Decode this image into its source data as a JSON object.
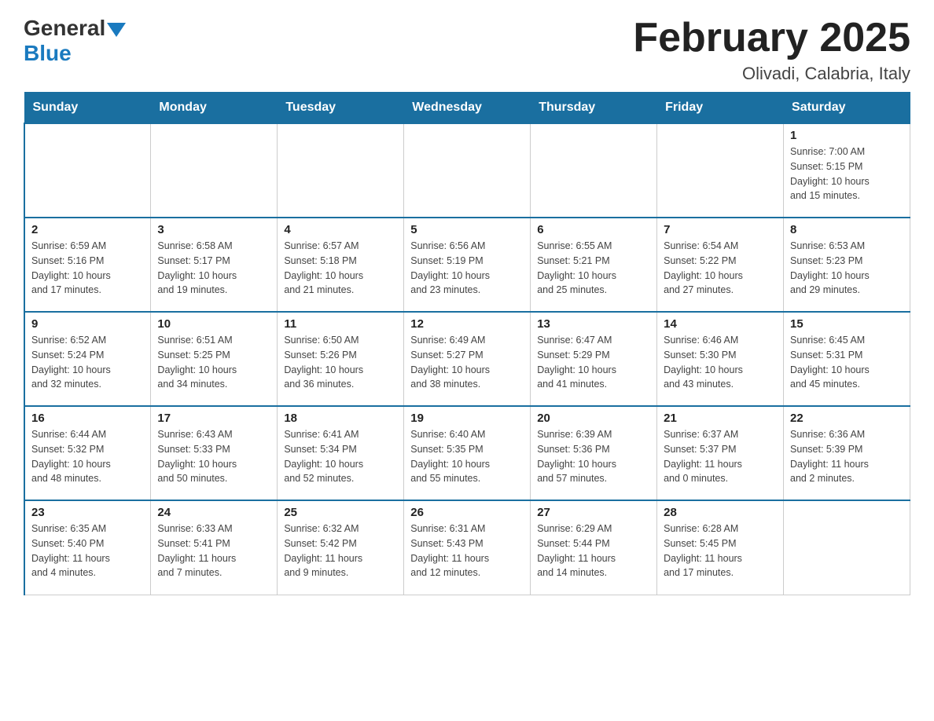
{
  "header": {
    "logo": {
      "general": "General",
      "blue": "Blue"
    },
    "title": "February 2025",
    "location": "Olivadi, Calabria, Italy"
  },
  "days_of_week": [
    "Sunday",
    "Monday",
    "Tuesday",
    "Wednesday",
    "Thursday",
    "Friday",
    "Saturday"
  ],
  "weeks": [
    {
      "days": [
        {
          "num": "",
          "info": ""
        },
        {
          "num": "",
          "info": ""
        },
        {
          "num": "",
          "info": ""
        },
        {
          "num": "",
          "info": ""
        },
        {
          "num": "",
          "info": ""
        },
        {
          "num": "",
          "info": ""
        },
        {
          "num": "1",
          "info": "Sunrise: 7:00 AM\nSunset: 5:15 PM\nDaylight: 10 hours\nand 15 minutes."
        }
      ]
    },
    {
      "days": [
        {
          "num": "2",
          "info": "Sunrise: 6:59 AM\nSunset: 5:16 PM\nDaylight: 10 hours\nand 17 minutes."
        },
        {
          "num": "3",
          "info": "Sunrise: 6:58 AM\nSunset: 5:17 PM\nDaylight: 10 hours\nand 19 minutes."
        },
        {
          "num": "4",
          "info": "Sunrise: 6:57 AM\nSunset: 5:18 PM\nDaylight: 10 hours\nand 21 minutes."
        },
        {
          "num": "5",
          "info": "Sunrise: 6:56 AM\nSunset: 5:19 PM\nDaylight: 10 hours\nand 23 minutes."
        },
        {
          "num": "6",
          "info": "Sunrise: 6:55 AM\nSunset: 5:21 PM\nDaylight: 10 hours\nand 25 minutes."
        },
        {
          "num": "7",
          "info": "Sunrise: 6:54 AM\nSunset: 5:22 PM\nDaylight: 10 hours\nand 27 minutes."
        },
        {
          "num": "8",
          "info": "Sunrise: 6:53 AM\nSunset: 5:23 PM\nDaylight: 10 hours\nand 29 minutes."
        }
      ]
    },
    {
      "days": [
        {
          "num": "9",
          "info": "Sunrise: 6:52 AM\nSunset: 5:24 PM\nDaylight: 10 hours\nand 32 minutes."
        },
        {
          "num": "10",
          "info": "Sunrise: 6:51 AM\nSunset: 5:25 PM\nDaylight: 10 hours\nand 34 minutes."
        },
        {
          "num": "11",
          "info": "Sunrise: 6:50 AM\nSunset: 5:26 PM\nDaylight: 10 hours\nand 36 minutes."
        },
        {
          "num": "12",
          "info": "Sunrise: 6:49 AM\nSunset: 5:27 PM\nDaylight: 10 hours\nand 38 minutes."
        },
        {
          "num": "13",
          "info": "Sunrise: 6:47 AM\nSunset: 5:29 PM\nDaylight: 10 hours\nand 41 minutes."
        },
        {
          "num": "14",
          "info": "Sunrise: 6:46 AM\nSunset: 5:30 PM\nDaylight: 10 hours\nand 43 minutes."
        },
        {
          "num": "15",
          "info": "Sunrise: 6:45 AM\nSunset: 5:31 PM\nDaylight: 10 hours\nand 45 minutes."
        }
      ]
    },
    {
      "days": [
        {
          "num": "16",
          "info": "Sunrise: 6:44 AM\nSunset: 5:32 PM\nDaylight: 10 hours\nand 48 minutes."
        },
        {
          "num": "17",
          "info": "Sunrise: 6:43 AM\nSunset: 5:33 PM\nDaylight: 10 hours\nand 50 minutes."
        },
        {
          "num": "18",
          "info": "Sunrise: 6:41 AM\nSunset: 5:34 PM\nDaylight: 10 hours\nand 52 minutes."
        },
        {
          "num": "19",
          "info": "Sunrise: 6:40 AM\nSunset: 5:35 PM\nDaylight: 10 hours\nand 55 minutes."
        },
        {
          "num": "20",
          "info": "Sunrise: 6:39 AM\nSunset: 5:36 PM\nDaylight: 10 hours\nand 57 minutes."
        },
        {
          "num": "21",
          "info": "Sunrise: 6:37 AM\nSunset: 5:37 PM\nDaylight: 11 hours\nand 0 minutes."
        },
        {
          "num": "22",
          "info": "Sunrise: 6:36 AM\nSunset: 5:39 PM\nDaylight: 11 hours\nand 2 minutes."
        }
      ]
    },
    {
      "days": [
        {
          "num": "23",
          "info": "Sunrise: 6:35 AM\nSunset: 5:40 PM\nDaylight: 11 hours\nand 4 minutes."
        },
        {
          "num": "24",
          "info": "Sunrise: 6:33 AM\nSunset: 5:41 PM\nDaylight: 11 hours\nand 7 minutes."
        },
        {
          "num": "25",
          "info": "Sunrise: 6:32 AM\nSunset: 5:42 PM\nDaylight: 11 hours\nand 9 minutes."
        },
        {
          "num": "26",
          "info": "Sunrise: 6:31 AM\nSunset: 5:43 PM\nDaylight: 11 hours\nand 12 minutes."
        },
        {
          "num": "27",
          "info": "Sunrise: 6:29 AM\nSunset: 5:44 PM\nDaylight: 11 hours\nand 14 minutes."
        },
        {
          "num": "28",
          "info": "Sunrise: 6:28 AM\nSunset: 5:45 PM\nDaylight: 11 hours\nand 17 minutes."
        },
        {
          "num": "",
          "info": ""
        }
      ]
    }
  ],
  "colors": {
    "header_bg": "#1a6fa0",
    "header_text": "#ffffff",
    "border_accent": "#1a6fa0"
  }
}
